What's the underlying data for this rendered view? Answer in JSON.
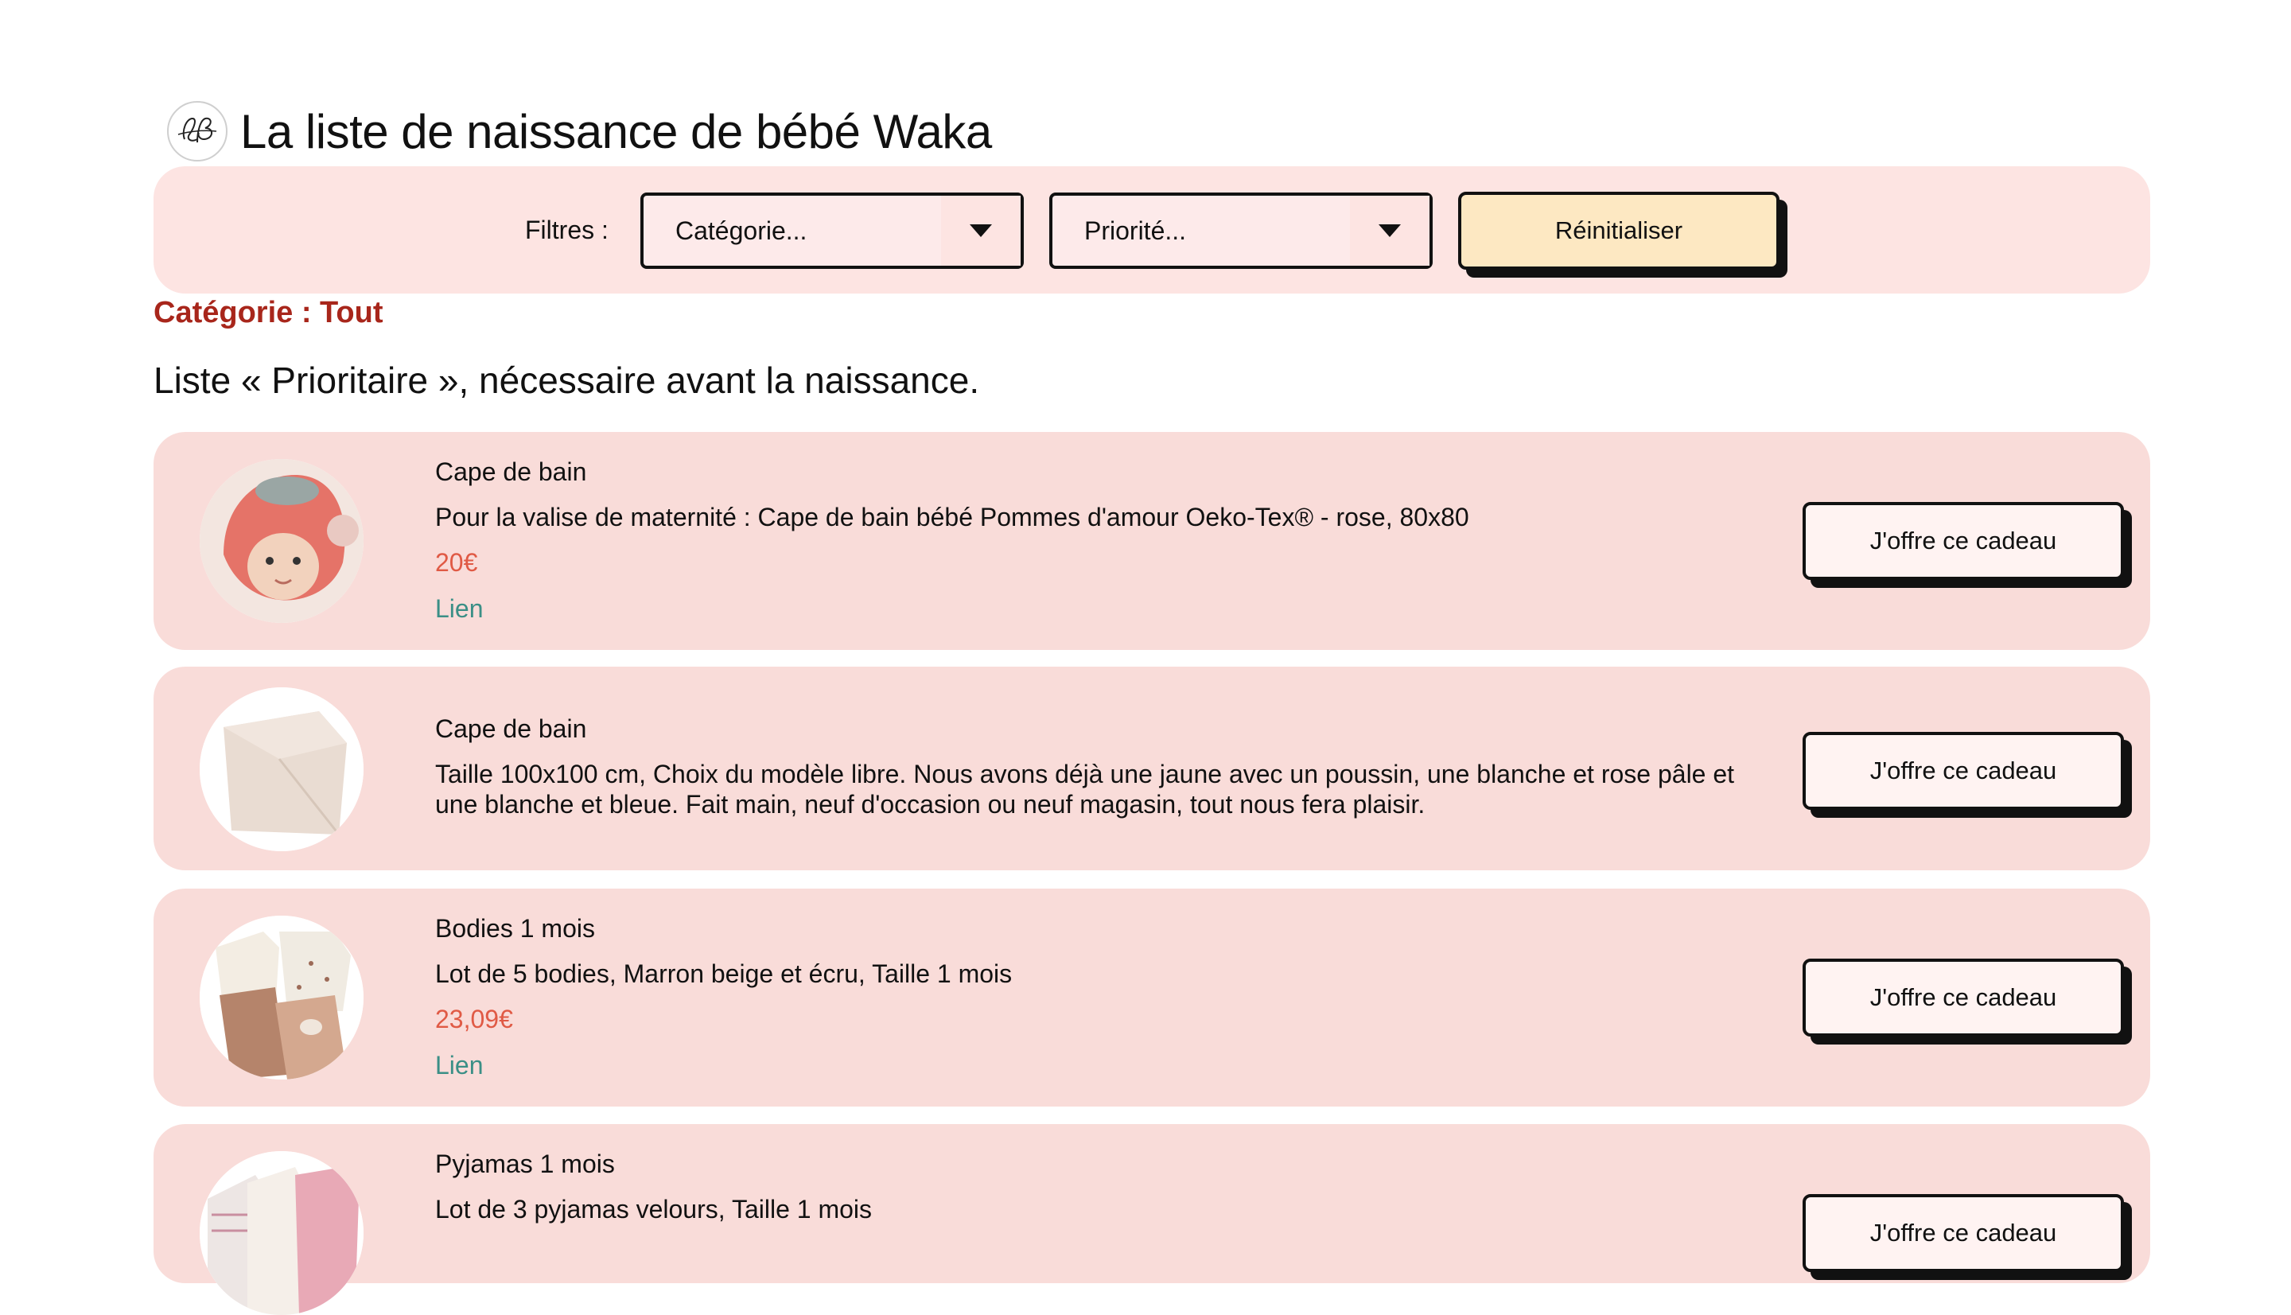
{
  "header": {
    "title": "La liste de naissance de bébé Waka",
    "logo_icon": "lb-monogram-logo"
  },
  "filters": {
    "label": "Filtres :",
    "category_select": "Catégorie...",
    "priority_select": "Priorité...",
    "reset_label": "Réinitialiser"
  },
  "category_heading": "Catégorie : Tout",
  "section_heading": "Liste « Prioritaire », nécessaire avant la naissance.",
  "colors": {
    "card_bg": "#f9dcd9",
    "filter_bg": "#fde4e2",
    "reset_bg": "#fde8c2",
    "category_text": "#a8261b",
    "price": "#e05a45",
    "link": "#3b8f86"
  },
  "items": [
    {
      "name": "Cape de bain",
      "desc": "Pour la valise de maternité : Cape de bain bébé Pommes d'amour Oeko-Tex® - rose, 80x80",
      "price": "20€",
      "link": "Lien",
      "button": "J'offre ce cadeau"
    },
    {
      "name": "Cape de bain",
      "desc": "Taille 100x100 cm, Choix du modèle libre. Nous avons déjà une jaune avec un poussin, une blanche et rose pâle et une blanche et bleue. Fait main, neuf d'occasion ou neuf magasin, tout nous fera plaisir.",
      "button": "J'offre ce cadeau"
    },
    {
      "name": "Bodies 1 mois",
      "desc": "Lot de 5 bodies, Marron beige et écru, Taille 1 mois",
      "price": "23,09€",
      "link": "Lien",
      "button": "J'offre ce cadeau"
    },
    {
      "name": "Pyjamas 1 mois",
      "desc": "Lot de 3 pyjamas velours, Taille 1 mois",
      "button": "J'offre ce cadeau"
    }
  ]
}
